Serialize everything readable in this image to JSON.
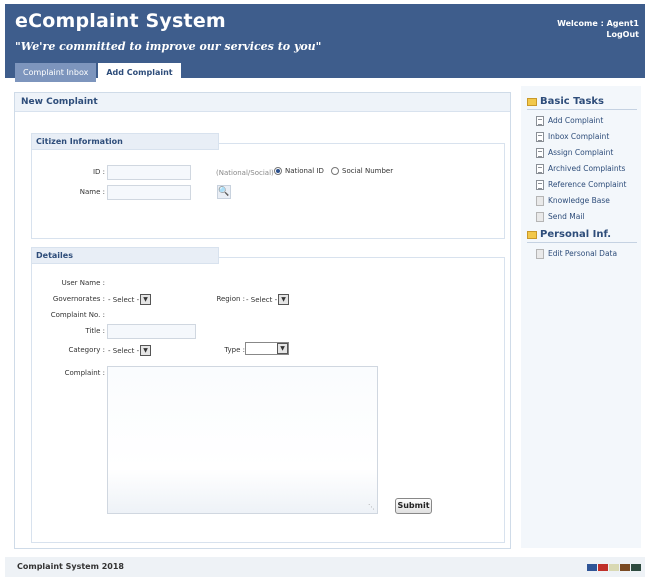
{
  "header": {
    "title": "eComplaint System",
    "slogan": "\"We're committed to improve our services to you\"",
    "welcome": "Welcome : Agent1",
    "logout": "LogOut"
  },
  "tabs": [
    {
      "label": "Complaint Inbox",
      "active": false
    },
    {
      "label": "Add Complaint",
      "active": true
    }
  ],
  "main": {
    "title": "New Complaint",
    "citizen": {
      "legend": "Citizen Information",
      "id_label": "ID :",
      "id_value": "",
      "name_label": "Name :",
      "name_value": "",
      "hint": "(National/Social)",
      "radio_national": "National ID",
      "radio_social": "Social Number",
      "selected": "National ID"
    },
    "details": {
      "legend": "Detailes",
      "user_name_label": "User Name :",
      "user_name_value": "",
      "governorates_label": "Governorates :",
      "governorates_value": "- Select -",
      "region_label": "Region :",
      "region_value": "- Select -",
      "complaint_no_label": "Complaint No. :",
      "complaint_no_value": "",
      "title_label": "Title :",
      "title_value": "",
      "category_label": "Category :",
      "category_value": "- Select -",
      "type_label": "Type :",
      "type_value": "",
      "complaint_label": "Complaint :",
      "complaint_value": "",
      "submit": "Submit"
    }
  },
  "sidebar": {
    "basic_tasks_title": "Basic Tasks",
    "basic_tasks": [
      {
        "label": "Add Complaint",
        "icon": "document-icon"
      },
      {
        "label": "Inbox Complaint",
        "icon": "document-icon"
      },
      {
        "label": "Assign Complaint",
        "icon": "document-icon"
      },
      {
        "label": "Archived Complaints",
        "icon": "document-icon"
      },
      {
        "label": "Reference Complaint",
        "icon": "document-icon"
      },
      {
        "label": "Knowledge Base",
        "icon": "page-icon"
      },
      {
        "label": "Send Mail",
        "icon": "page-icon"
      }
    ],
    "personal_title": "Personal Inf.",
    "personal": [
      {
        "label": "Edit Personal Data",
        "icon": "page-icon"
      }
    ]
  },
  "footer": {
    "text": "Complaint System  2018",
    "swatches": [
      "#2f5597",
      "#c0302a",
      "#d9d9b3",
      "#7a4a23",
      "#2d4a3e"
    ]
  },
  "colors": {
    "header_bg": "#3e5d8c",
    "accent": "#2e4d7a",
    "tab_inactive": "#7d95bd"
  }
}
